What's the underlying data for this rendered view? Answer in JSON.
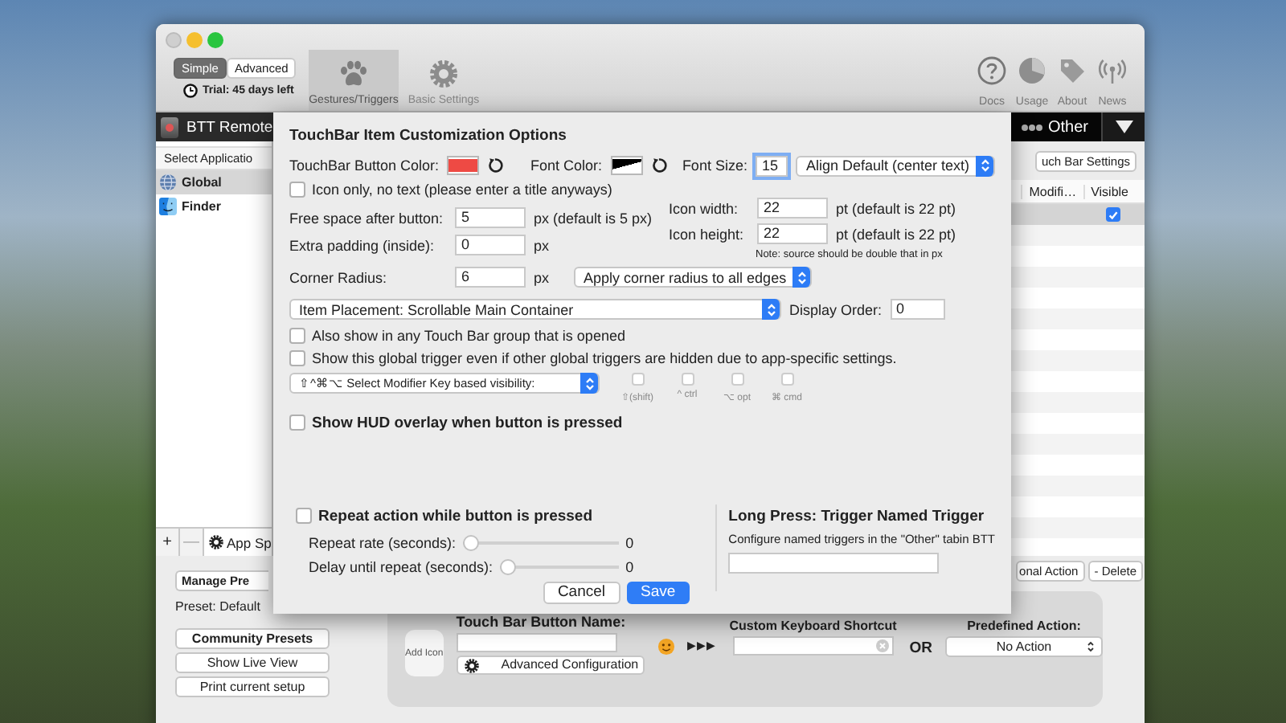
{
  "mode_switch": [
    {
      "label": "Simple",
      "selected": true
    },
    {
      "label": "Advanced",
      "selected": false
    }
  ],
  "trial": "Trial: 45 days left",
  "toolbar_tabs": [
    {
      "label": "Gestures/Triggers",
      "selected": true,
      "kind": "paw"
    },
    {
      "label": "Basic Settings",
      "selected": false,
      "kind": "gear"
    }
  ],
  "toolbar_links": [
    {
      "label": "Docs",
      "kind": "help"
    },
    {
      "label": "Usage",
      "kind": "pie"
    },
    {
      "label": "About",
      "kind": "tag"
    },
    {
      "label": "News",
      "kind": "antenna"
    }
  ],
  "device_bar": {
    "left": "BTT Remote",
    "right": "Other"
  },
  "sidebar": {
    "header": "Select Applicatio",
    "items": [
      {
        "label": "Global",
        "selected": true,
        "kind": "globe"
      },
      {
        "label": "Finder",
        "selected": false,
        "kind": "finder"
      }
    ],
    "add": "+",
    "remove": "—",
    "app_button": "App Sp"
  },
  "table": {
    "settings_button": "uch Bar Settings",
    "columns": [
      "Modifi…",
      "Visible"
    ],
    "rows": [
      {
        "selected": true,
        "visible": true
      }
    ],
    "actions": [
      "onal Action",
      "- Delete"
    ]
  },
  "presets": {
    "manage": "Manage Pre",
    "current": "Preset: Default",
    "community": "Community Presets",
    "buttons": [
      "Show Live View",
      "Print current setup"
    ]
  },
  "config": {
    "add_icon": "Add Icon",
    "name_label": "Touch Bar Button Name:",
    "arrows": "▶▶▶",
    "shortcut_label": "Custom Keyboard Shortcut",
    "or": "OR",
    "action_label": "Predefined Action:",
    "action_value": "No Action",
    "advanced": "Advanced Configuration"
  },
  "sheet": {
    "title": "TouchBar Item Customization Options",
    "color_wells": [
      {
        "label": "TouchBar Button Color:",
        "color": "#ee4a44"
      },
      {
        "label": "Font Color:",
        "color": "#000000"
      }
    ],
    "font_size": {
      "label": "Font Size:",
      "value": "15",
      "focused": true
    },
    "align": "Align Default (center text)",
    "icon_only": {
      "label": "Icon only, no text (please enter a title anyways)",
      "checked": false
    },
    "spacing": [
      {
        "label": "Free space after button:",
        "value": "5",
        "unit": "px (default is 5 px)"
      },
      {
        "label": "Extra padding (inside):",
        "value": "0",
        "unit": "px"
      }
    ],
    "icon_size": [
      {
        "label": "Icon width:",
        "value": "22",
        "unit": "pt (default is 22 pt)"
      },
      {
        "label": "Icon height:",
        "value": "22",
        "unit": "pt (default is 22 pt)"
      }
    ],
    "note": "Note: source should be double that in px",
    "corner": {
      "label": "Corner Radius:",
      "value": "6",
      "unit": "px",
      "popup": "Apply corner radius to all edges"
    },
    "placement": "Item Placement: Scrollable Main Container",
    "display_order": {
      "label": "Display Order:",
      "value": "0"
    },
    "options": [
      {
        "label": "Also show in any Touch Bar group that is opened",
        "checked": false
      },
      {
        "label": "Show this global trigger even if other global triggers are hidden due to app-specific settings.",
        "checked": false
      }
    ],
    "modifier_popup": "⇧^⌘⌥ Select Modifier Key based visibility:",
    "modifiers": [
      {
        "label": "⇧(shift)",
        "checked": false
      },
      {
        "label": "^ ctrl",
        "checked": false
      },
      {
        "label": "⌥ opt",
        "checked": false
      },
      {
        "label": "⌘ cmd",
        "checked": false
      }
    ],
    "hud": {
      "label": "Show HUD overlay when button is pressed",
      "checked": false
    },
    "repeat": {
      "label": "Repeat action while button is pressed",
      "checked": false
    },
    "sliders": [
      {
        "label": "Repeat rate (seconds):",
        "level": 0,
        "reading": "0"
      },
      {
        "label": "Delay until repeat (seconds):",
        "level": 0,
        "reading": "0"
      }
    ],
    "buttons": [
      {
        "label": "Cancel",
        "kind": "secondary"
      },
      {
        "label": "Save",
        "kind": "primary"
      }
    ],
    "long_press": {
      "title": "Long Press: Trigger Named Trigger",
      "hint": "Configure named triggers in the \"Other\" tabin BTT"
    }
  }
}
